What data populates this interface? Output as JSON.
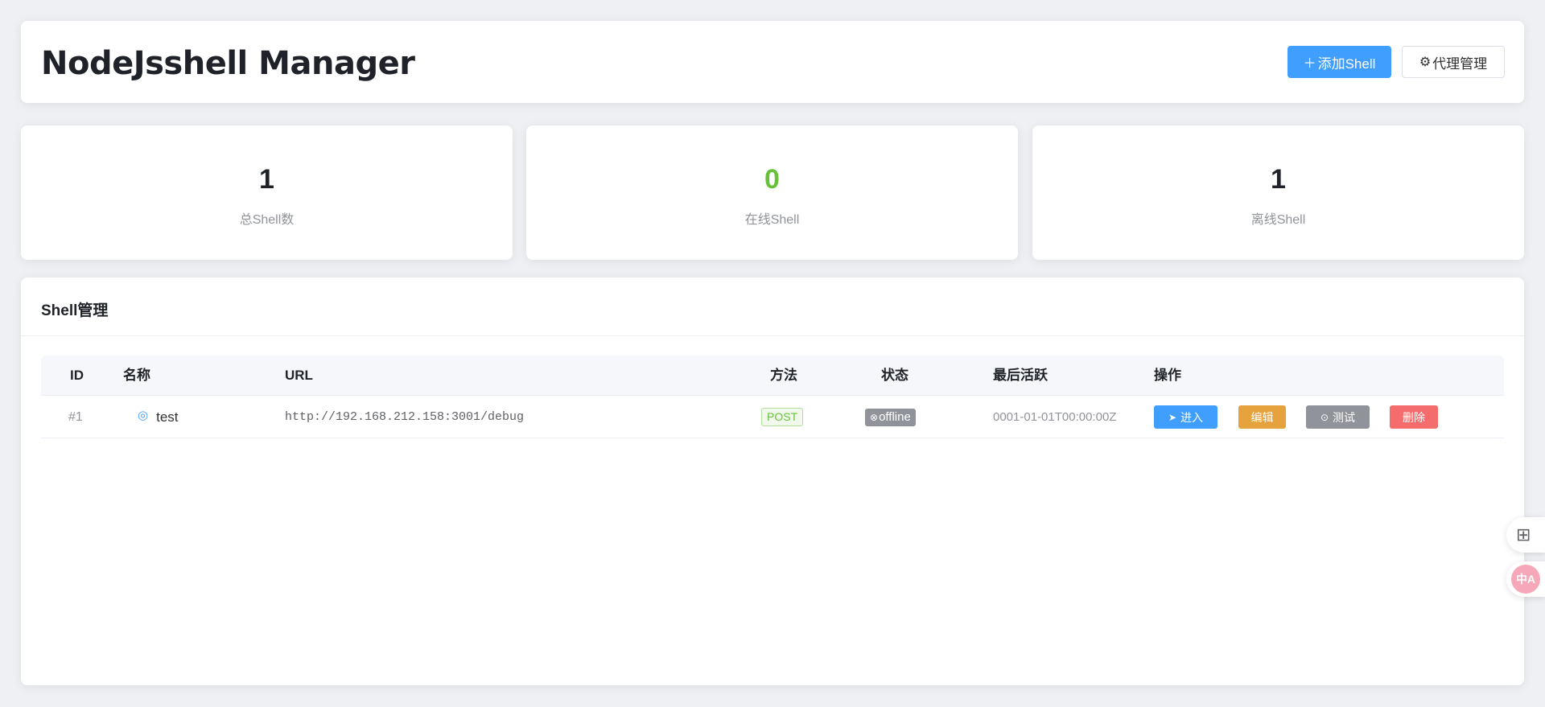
{
  "header": {
    "title": "NodeJsshell Manager",
    "add_button": {
      "icon": "plus-icon",
      "glyph": "＋",
      "label": "添加Shell"
    },
    "proxy_button": {
      "icon": "gear-icon",
      "glyph": "⚙",
      "label": "代理管理"
    }
  },
  "stats": [
    {
      "value": "1",
      "label": "总Shell数",
      "color": "#1f2329"
    },
    {
      "value": "0",
      "label": "在线Shell",
      "color": "#67c23a"
    },
    {
      "value": "1",
      "label": "离线Shell",
      "color": "#1f2329"
    }
  ],
  "panel": {
    "title": "Shell管理",
    "columns": [
      "ID",
      "名称",
      "URL",
      "方法",
      "状态",
      "最后活跃",
      "操作"
    ],
    "rows": [
      {
        "id": "#1",
        "name": "test",
        "name_icon": "chat-icon",
        "name_glyph": "◎",
        "url": "http://192.168.212.158:3001/debug",
        "method": "POST",
        "status_glyph": "⊗",
        "status": "offline",
        "last_active": "0001-01-01T00:00:00Z",
        "actions": {
          "enter": {
            "glyph": "➤",
            "label": "进入"
          },
          "edit": {
            "label": "编辑"
          },
          "test": {
            "glyph": "⊙",
            "label": "测试"
          },
          "delete": {
            "label": "删除"
          }
        }
      }
    ]
  },
  "floating": {
    "apps_glyph": "⊞",
    "translate_glyph": "中A"
  },
  "colors": {
    "primary": "#409eff",
    "success": "#67c23a",
    "warning": "#e6a23c",
    "danger": "#f56c6c",
    "info": "#909399"
  }
}
